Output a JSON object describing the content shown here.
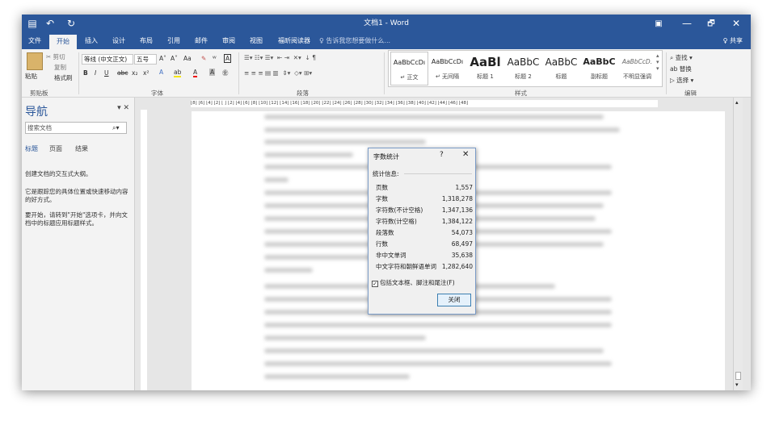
{
  "titlebar": {
    "title": "文档1 - Word",
    "save_icon": "save-icon",
    "undo_glyph": "↶",
    "redo_glyph": "↻",
    "restore_glyph": "▣",
    "minimize_glyph": "—",
    "maximize_glyph": "🗗",
    "close_glyph": "✕"
  },
  "menu": {
    "tabs": [
      "文件",
      "开始",
      "插入",
      "设计",
      "布局",
      "引用",
      "邮件",
      "审阅",
      "视图",
      "福昕阅读器"
    ],
    "active": "开始",
    "tell_me": "♀ 告诉我您想要做什么...",
    "share": "♀ 共享"
  },
  "ribbon": {
    "clipboard": {
      "paste": "粘贴",
      "cut": "✂ 剪切",
      "copy": "复制",
      "format_painter": "格式刷",
      "label": "剪贴板"
    },
    "font": {
      "font_name": "等线 (中文正文)",
      "font_size": "五号",
      "grow": "A˄",
      "shrink": "A˅",
      "case": "Aa",
      "clear": "✎",
      "phonetic": "ᵂ",
      "border_char": "A",
      "bold": "B",
      "italic": "I",
      "underline": "U",
      "strike": "abc",
      "sub": "x₂",
      "sup": "x²",
      "effects": "A",
      "highlight": "ab",
      "color": "A",
      "shading": "A",
      "circle": "㊎",
      "label": "字体"
    },
    "paragraph": {
      "label": "段落"
    },
    "styles": {
      "items": [
        {
          "preview": "AaBbCcDı",
          "name": "↵ 正文"
        },
        {
          "preview": "AaBbCcDı",
          "name": "↵ 无间隔"
        },
        {
          "preview": "AaBl",
          "name": "标题 1"
        },
        {
          "preview": "AaBbC",
          "name": "标题 2"
        },
        {
          "preview": "AaBbC",
          "name": "标题"
        },
        {
          "preview": "AaBbC",
          "name": "副标题"
        },
        {
          "preview": "AaBbCcD.",
          "name": "不明显强调"
        }
      ],
      "label": "样式"
    },
    "editing": {
      "find": "⌕ 查找 ▾",
      "replace": "ab 替换",
      "select": "▷ 选择 ▾",
      "label": "编辑"
    }
  },
  "nav": {
    "title": "导航",
    "close": "▾ ✕",
    "search_placeholder": "搜索文档",
    "tabs": [
      "标题",
      "页面",
      "结果"
    ],
    "msg1": "创建文档的交互式大纲。",
    "msg2": "它是跟踪您的具体位置或快速移动内容的好方式。",
    "msg3": "要开始，请转到\"开始\"选项卡，并向文档中的标题应用标题样式。"
  },
  "ruler": {
    "h_text": "⌊8⌋  ⌊6⌋  ⌊4⌋  ⌊2⌋  ⌊  ⌋  ⌊2⌋  ⌊4⌋  ⌊6⌋  ⌊8⌋  ⌊10⌋  ⌊12⌋  ⌊14⌋  ⌊16⌋  ⌊18⌋  ⌊20⌋  ⌊22⌋  ⌊24⌋  ⌊26⌋  ⌊28⌋  ⌊30⌋  ⌊32⌋  ⌊34⌋  ⌊36⌋  ⌊38⌋  ⌊40⌋  ⌊42⌋  ⌊44⌋  ⌊46⌋  ⌊48⌋"
  },
  "dialog": {
    "title": "字数统计",
    "help": "?",
    "close": "✕",
    "group_label": "统计信息:",
    "rows": [
      {
        "k": "页数",
        "v": "1,557"
      },
      {
        "k": "字数",
        "v": "1,318,278"
      },
      {
        "k": "字符数(不计空格)",
        "v": "1,347,136"
      },
      {
        "k": "字符数(计空格)",
        "v": "1,384,122"
      },
      {
        "k": "段落数",
        "v": "54,073"
      },
      {
        "k": "行数",
        "v": "68,497"
      },
      {
        "k": "非中文单词",
        "v": "35,638"
      },
      {
        "k": "中文字符和朝鲜语单词",
        "v": "1,282,640"
      }
    ],
    "checkbox_label": "包括文本框、脚注和尾注(F)",
    "checkbox_checked": "✓",
    "close_button": "关闭"
  }
}
